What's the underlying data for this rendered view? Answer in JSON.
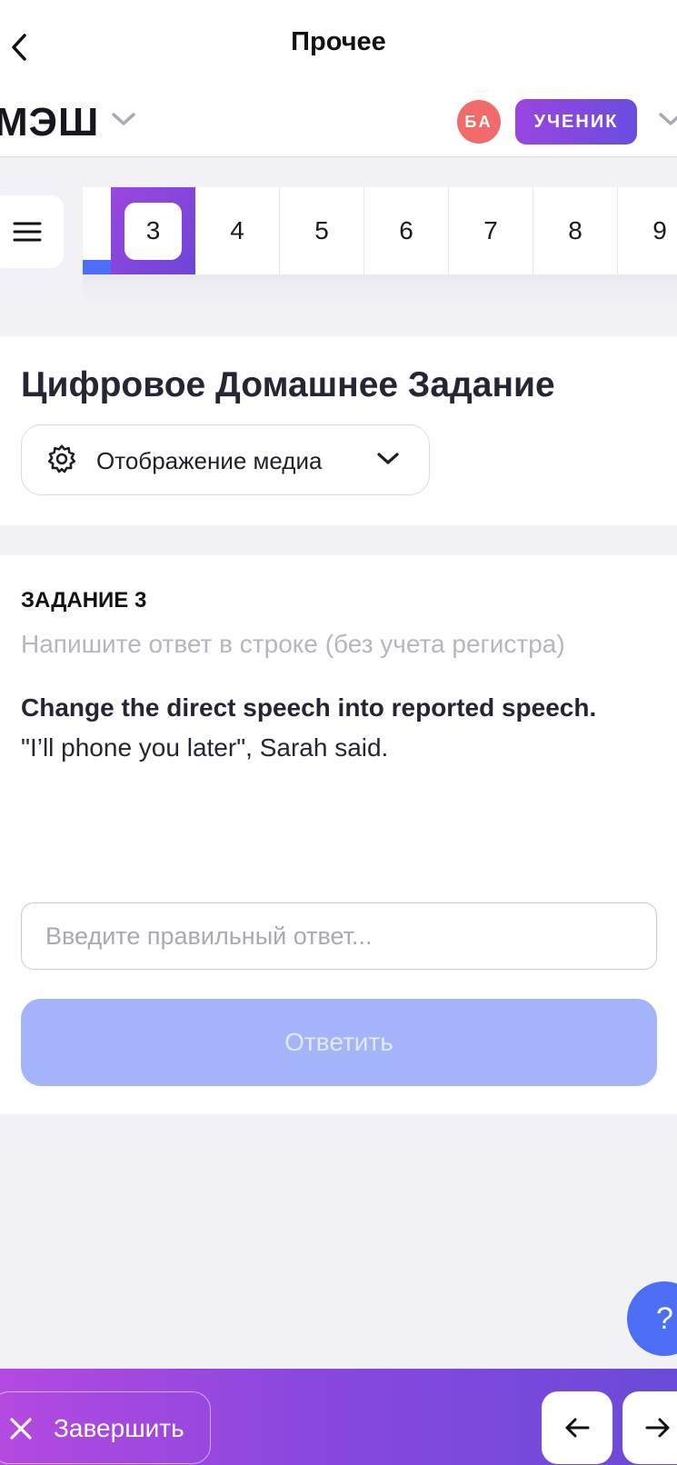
{
  "nav": {
    "title": "Прочее"
  },
  "header": {
    "logo": "МЭШ",
    "avatar_initials": "БА",
    "role": "УЧЕНИК"
  },
  "tabs": {
    "items": [
      "3",
      "4",
      "5",
      "6",
      "7",
      "8",
      "9"
    ],
    "active": "3"
  },
  "page": {
    "title": "Цифровое Домашнее Задание",
    "media_dropdown": "Отображение медиа"
  },
  "task": {
    "number": "ЗАДАНИЕ 3",
    "hint": "Напишите ответ в строке (без учета регистра)",
    "instruction": "Change the direct speech into reported speech.",
    "sentence": "\"I’ll phone you later\", Sarah said.",
    "answer_placeholder": "Введите правильный ответ...",
    "answer_value": "",
    "submit_label": "Ответить"
  },
  "help": {
    "label": "?"
  },
  "footer": {
    "finish_label": "Завершить"
  },
  "colors": {
    "accent": "#4b6ef5",
    "gradient_start": "#b449e0",
    "gradient_end": "#6a4ad8",
    "avatar": "#f26b6b"
  }
}
